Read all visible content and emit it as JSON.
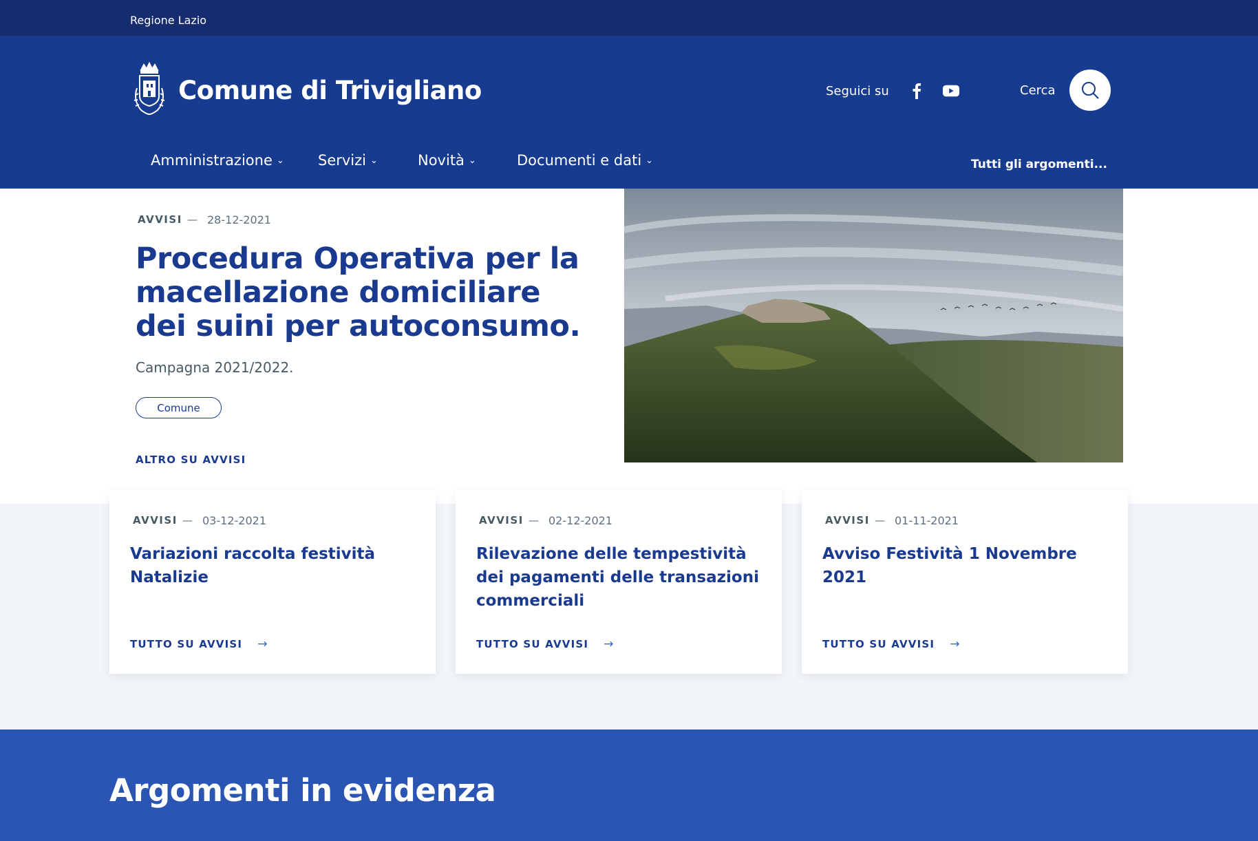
{
  "header": {
    "region": "Regione Lazio",
    "site_name": "Comune di Trivigliano",
    "follow_label": "Seguici su",
    "search_label": "Cerca",
    "social_icons": [
      "facebook-icon",
      "youtube-icon"
    ]
  },
  "nav": {
    "items": [
      {
        "label": "Amministrazione"
      },
      {
        "label": "Servizi"
      },
      {
        "label": "Novità"
      },
      {
        "label": "Documenti e dati"
      }
    ],
    "all_topics": "Tutti gli argomenti..."
  },
  "hero": {
    "category": "AVVISI",
    "dash": "—",
    "date": "28-12-2021",
    "title": "Procedura Operativa per la macellazione domiciliare dei suini per autoconsumo.",
    "subtitle": "Campagna 2021/2022.",
    "chip": "Comune",
    "more": "ALTRO SU AVVISI"
  },
  "cards": [
    {
      "category": "AVVISI",
      "dash": "—",
      "date": "03-12-2021",
      "title": "Variazioni raccolta festività Natalizie",
      "more": "TUTTO SU AVVISI"
    },
    {
      "category": "AVVISI",
      "dash": "—",
      "date": "02-12-2021",
      "title": "Rilevazione delle tempestività dei pagamenti delle transazioni commerciali",
      "more": "TUTTO SU AVVISI"
    },
    {
      "category": "AVVISI",
      "dash": "—",
      "date": "01-11-2021",
      "title": "Avviso Festività 1 Novembre 2021",
      "more": "TUTTO SU AVVISI"
    }
  ],
  "topics": {
    "heading": "Argomenti in evidenza"
  },
  "colors": {
    "slim_header": "#152d6e",
    "header": "#173b8e",
    "primary_text": "#1a3a8f",
    "topics_band": "#2b55b3",
    "cards_band": "#f2f5f9"
  }
}
